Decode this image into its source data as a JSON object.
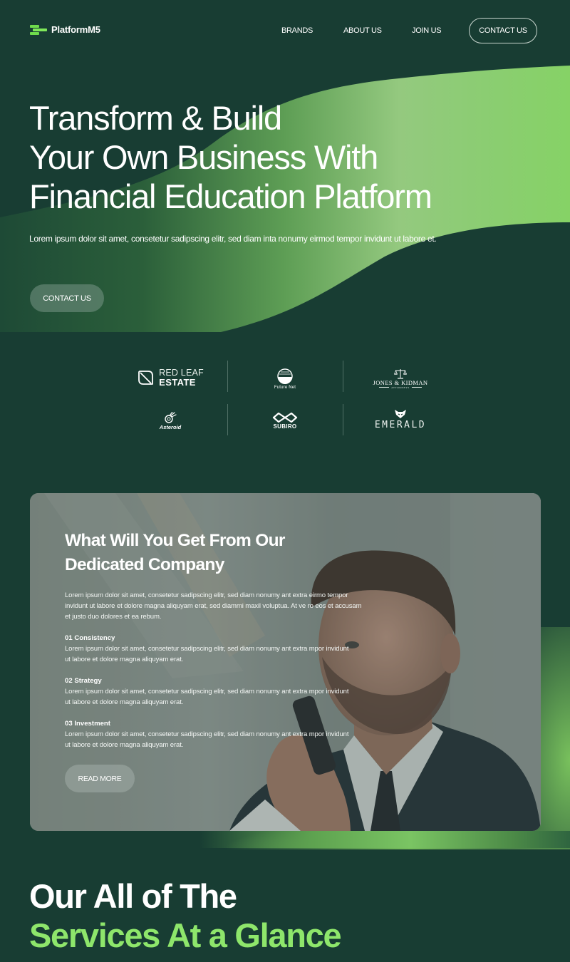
{
  "header": {
    "logo_text": "PlatformM5",
    "nav": [
      {
        "label": "BRANDS"
      },
      {
        "label": "ABOUT US"
      },
      {
        "label": "JOIN US"
      }
    ],
    "contact_label": "CONTACT US"
  },
  "hero": {
    "title_lines": [
      "Transform & Build",
      "Your Own Business With",
      "Financial Education Platform"
    ],
    "subtitle": "Lorem ipsum dolor sit amet, consetetur sadipscing elitr, sed diam inta nonumy eirmod tempor invidunt ut labore et.",
    "cta_label": "CONTACT US"
  },
  "brands": {
    "items": [
      {
        "name": "Red Leaf Estate",
        "line1": "RED LEAF",
        "line2": "ESTATE",
        "icon": "leaf-icon"
      },
      {
        "name": "Future Net",
        "label": "Future Net",
        "icon": "globe-icon"
      },
      {
        "name": "Jones & Kidman",
        "label": "JONES & KIDMAN",
        "sub": "ATTORNEYS",
        "icon": "scales-icon"
      },
      {
        "name": "Asteroid",
        "label": "Asteroid",
        "icon": "asteroid-icon"
      },
      {
        "name": "Subiro",
        "label": "SUBIRO",
        "icon": "infinity-icon"
      },
      {
        "name": "Emerald",
        "label": "EMERALD",
        "icon": "fox-icon"
      }
    ]
  },
  "feature": {
    "title_lines": [
      "What Will You Get From Our",
      "Dedicated Company"
    ],
    "intro": "Lorem ipsum dolor sit amet, consetetur sadipscing elitr, sed diam nonumy ant extra eirmo tempor invidunt ut labore et dolore magna aliquyam erat, sed diammi maxil voluptua. At ve ro eos et accusam et justo duo dolores et ea rebum.",
    "items": [
      {
        "heading": "01  Consistency",
        "body": "Lorem ipsum dolor sit amet, consetetur sadipscing elitr, sed diam nonumy ant extra mpor invidunt ut labore et dolore magna aliquyam erat."
      },
      {
        "heading": "02 Strategy",
        "body": "Lorem ipsum dolor sit amet, consetetur sadipscing elitr, sed diam nonumy ant extra mpor invidunt ut labore et dolore magna aliquyam erat."
      },
      {
        "heading": "03 Investment",
        "body": "Lorem ipsum dolor sit amet, consetetur sadipscing elitr, sed diam nonumy ant extra mpor invidunt ut labore et dolore magna aliquyam erat."
      }
    ],
    "cta_label": "READ MORE",
    "image_alt": "businessman-on-phone-photo"
  },
  "services": {
    "title_line1": "Our All of The",
    "title_line2": "Services At a Glance"
  },
  "colors": {
    "background": "#183d33",
    "accent_green": "#8ee66b",
    "logo_green": "#6fdc4c"
  }
}
